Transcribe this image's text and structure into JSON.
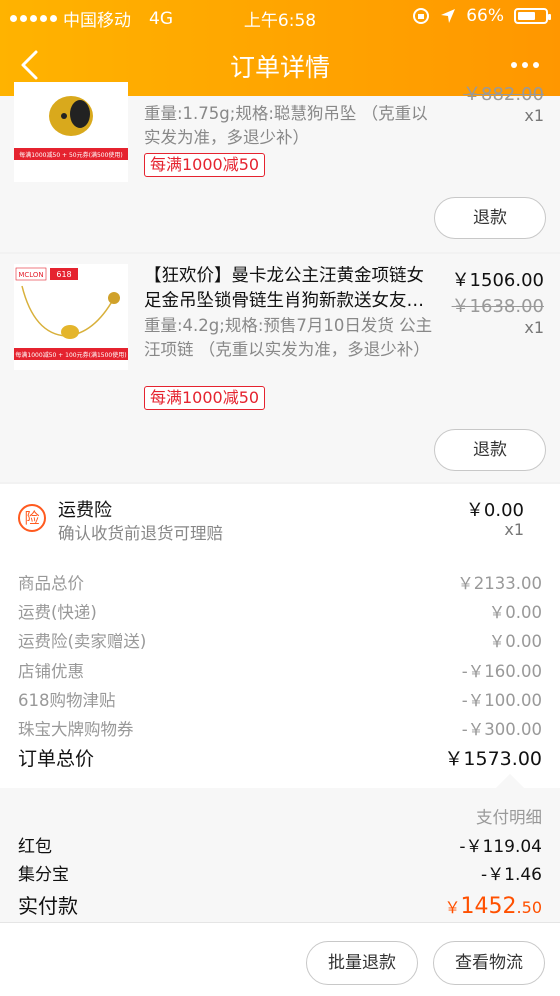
{
  "status_bar": {
    "carrier": "中国移动",
    "network": "4G",
    "time": "上午6:58",
    "battery": "66%",
    "battery_level": 0.66
  },
  "nav": {
    "title": "订单详情"
  },
  "items": [
    {
      "title": "",
      "spec": "重量:1.75g;规格:聪慧狗吊坠 （克重以实发为准，多退少补）",
      "tag": "每满1000减50",
      "price": "",
      "old_price": "￥882.00",
      "qty": "x1",
      "refund_label": "退款",
      "thumb_strip_text": "每满1000减50 + 50元券(满500使用)"
    },
    {
      "title": "【狂欢价】曼卡龙公主汪黄金项链女足金吊坠锁骨链生肖狗新款送女友…",
      "spec": "重量:4.2g;规格:预售7月10日发货 公主汪项链 （克重以实发为准，多退少补）",
      "tag": "每满1000减50",
      "price": "￥1506.00",
      "old_price": "￥1638.00",
      "qty": "x1",
      "refund_label": "退款",
      "thumb_brand": "MCLON",
      "thumb_badge": "618",
      "thumb_strip_text": "每满1000减50 + 100元券(满1500使用)"
    }
  ],
  "insurance": {
    "icon_char": "险",
    "title": "运费险",
    "subtitle": "确认收货前退货可理赔",
    "price": "￥0.00",
    "qty": "x1"
  },
  "summary": [
    {
      "label": "商品总价",
      "value": "￥2133.00"
    },
    {
      "label": "运费(快递)",
      "value": "￥0.00"
    },
    {
      "label": "运费险(卖家赠送)",
      "value": "￥0.00"
    },
    {
      "label": "店铺优惠",
      "value": "-￥160.00"
    },
    {
      "label": "618购物津贴",
      "value": "-￥100.00"
    },
    {
      "label": "珠宝大牌购物券",
      "value": "-￥300.00"
    }
  ],
  "order_total": {
    "label": "订单总价",
    "value": "￥1573.00"
  },
  "payment": {
    "detail_label": "支付明细",
    "rows": [
      {
        "label": "红包",
        "value": "-￥119.04"
      },
      {
        "label": "集分宝",
        "value": "-￥1.46"
      }
    ],
    "paid_label": "实付款",
    "paid_currency": "￥",
    "paid_int": "1452",
    "paid_dec": ".50"
  },
  "bottom": {
    "batch_refund": "批量退款",
    "logistics": "查看物流"
  },
  "colors": {
    "accent": "#ff9700",
    "red": "#e5232f",
    "pay_orange": "#ff5000"
  }
}
